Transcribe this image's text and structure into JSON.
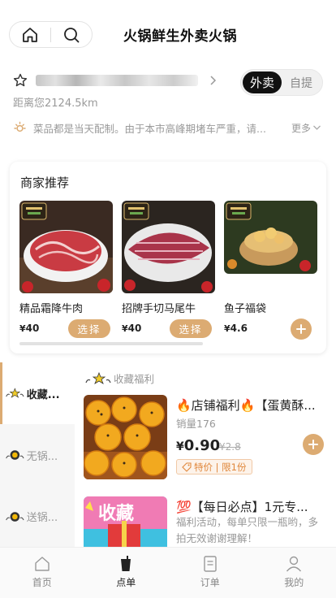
{
  "header": {
    "title": "火锅鲜生外卖火锅",
    "home_icon": "home-icon",
    "search_icon": "search-icon"
  },
  "store": {
    "distance": "距离您2124.5km",
    "delivery_modes": [
      "外卖",
      "自提"
    ],
    "selected_mode": "外卖"
  },
  "notice": {
    "text": "菜品都是当天配制。由于本市高峰期堵车严重，请...",
    "more_label": "更多"
  },
  "recommend": {
    "title": "商家推荐",
    "items": [
      {
        "name": "精品霜降牛肉",
        "currency": "¥",
        "price": "40",
        "action": "选择"
      },
      {
        "name": "招牌手切马尾牛",
        "currency": "¥",
        "price": "40",
        "action": "选择"
      },
      {
        "name": "鱼子福袋",
        "currency": "¥",
        "price": "4.6",
        "action": "+"
      }
    ]
  },
  "categories": [
    {
      "label": "收藏..."
    },
    {
      "label": "无锅..."
    },
    {
      "label": "送锅..."
    }
  ],
  "section": {
    "title": "收藏福利"
  },
  "goods": [
    {
      "title": "🔥店铺福利🔥【蛋黄酥...",
      "sales": "销量176",
      "currency": "¥",
      "price": "0.90",
      "old_price": "¥2.8",
      "tag": "特价 | 限1份"
    },
    {
      "title": "💯【每日必点】1元专...",
      "desc": "福利活动，每单只限一瓶哟，多拍无效谢谢理解！"
    }
  ],
  "tabbar": {
    "items": [
      {
        "label": "首页",
        "icon": "home-icon"
      },
      {
        "label": "点单",
        "icon": "cup-icon"
      },
      {
        "label": "订单",
        "icon": "order-icon"
      },
      {
        "label": "我的",
        "icon": "user-icon"
      }
    ],
    "active": "点单"
  },
  "colors": {
    "accent": "#dcab72",
    "tag_text": "#e0873b",
    "toggle_active": "#111111"
  }
}
